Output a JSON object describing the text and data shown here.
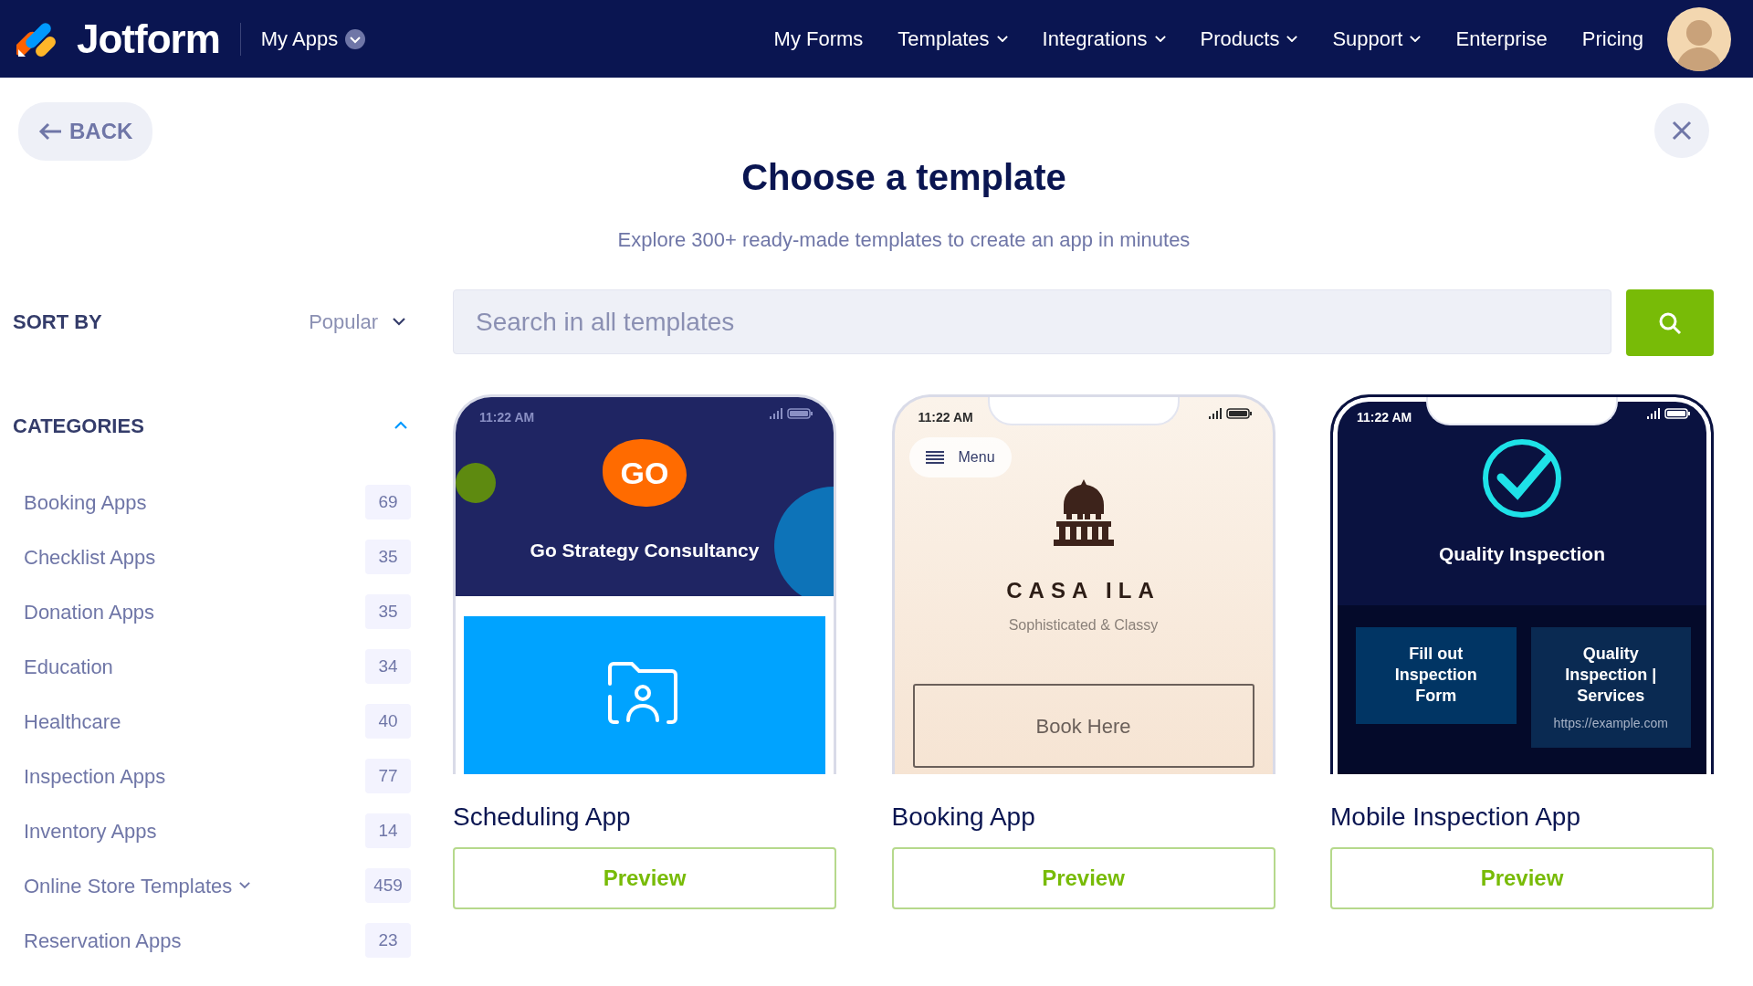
{
  "header": {
    "logo": "Jotform",
    "app_menu": "My Apps",
    "nav": [
      {
        "label": "My Forms",
        "dropdown": false
      },
      {
        "label": "Templates",
        "dropdown": true
      },
      {
        "label": "Integrations",
        "dropdown": true
      },
      {
        "label": "Products",
        "dropdown": true
      },
      {
        "label": "Support",
        "dropdown": true
      },
      {
        "label": "Enterprise",
        "dropdown": false
      },
      {
        "label": "Pricing",
        "dropdown": false
      }
    ]
  },
  "back": "BACK",
  "title": "Choose a template",
  "subtitle": "Explore 300+ ready-made templates to create an app in minutes",
  "sort": {
    "label": "SORT BY",
    "value": "Popular"
  },
  "categories": {
    "title": "CATEGORIES",
    "expanded": true,
    "items": [
      {
        "label": "Booking Apps",
        "count": "69",
        "has_children": false
      },
      {
        "label": "Checklist Apps",
        "count": "35",
        "has_children": false
      },
      {
        "label": "Donation Apps",
        "count": "35",
        "has_children": false
      },
      {
        "label": "Education",
        "count": "34",
        "has_children": false
      },
      {
        "label": "Healthcare",
        "count": "40",
        "has_children": false
      },
      {
        "label": "Inspection Apps",
        "count": "77",
        "has_children": false
      },
      {
        "label": "Inventory Apps",
        "count": "14",
        "has_children": false
      },
      {
        "label": "Online Store Templates",
        "count": "459",
        "has_children": true
      },
      {
        "label": "Reservation Apps",
        "count": "23",
        "has_children": false
      }
    ]
  },
  "search": {
    "placeholder": "Search in all templates"
  },
  "templates": [
    {
      "kind": "consultancy",
      "name": "Scheduling App",
      "action": "Preview",
      "screen": {
        "time": "11:22 AM",
        "logo": "GO",
        "heading": "Go Strategy Consultancy"
      }
    },
    {
      "kind": "restaurant",
      "name": "Booking App",
      "action": "Preview",
      "screen": {
        "time": "11:22 AM",
        "menu": "Menu",
        "brand": "CASA ILA",
        "tagline": "Sophisticated & Classy",
        "button": "Book Here"
      }
    },
    {
      "kind": "inspection",
      "name": "Mobile Inspection App",
      "action": "Preview",
      "screen": {
        "time": "11:22 AM",
        "heading": "Quality Inspection",
        "tiles": [
          "Fill out Inspection Form",
          "Quality Inspection | Services"
        ],
        "url": "https://example.com"
      }
    }
  ]
}
